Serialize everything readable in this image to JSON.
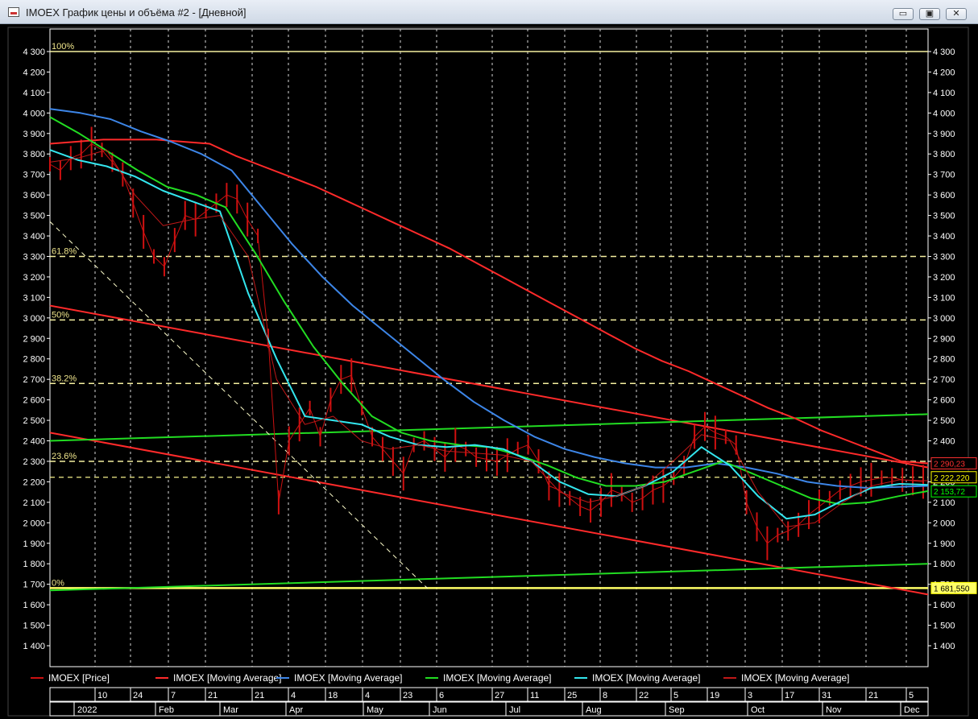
{
  "window": {
    "title": "IMOEX График цены и объёма #2 - [Дневной]",
    "minimize_glyph": "▭",
    "maximize_glyph": "▣",
    "close_glyph": "✕"
  },
  "chart_data": {
    "type": "line",
    "ylim": [
      1350,
      4400
    ],
    "y_ticks": [
      "1 400",
      "1 500",
      "1 600",
      "1 700",
      "1 800",
      "1 900",
      "2 000",
      "2 100",
      "2 200",
      "2 300",
      "2 400",
      "2 500",
      "2 600",
      "2 700",
      "2 800",
      "2 900",
      "3 000",
      "3 100",
      "3 200",
      "3 300",
      "3 400",
      "3 500",
      "3 600",
      "3 700",
      "3 800",
      "3 900",
      "4 000",
      "4 100",
      "4 200",
      "4 300"
    ],
    "x_day_ticks": [
      "10",
      "24",
      "7",
      "21",
      "21",
      "4",
      "18",
      "4",
      "23",
      "6",
      "27",
      "11",
      "25",
      "8",
      "22",
      "5",
      "19",
      "3",
      "17",
      "31",
      "21",
      "5"
    ],
    "x_month_ticks": [
      "2022",
      "Feb",
      "Mar",
      "Apr",
      "May",
      "Jun",
      "Jul",
      "Aug",
      "Sep",
      "Oct",
      "Nov",
      "Dec"
    ],
    "fibonacci_levels": [
      {
        "label": "100%",
        "value": 4300
      },
      {
        "label": "61.8%",
        "value": 3300
      },
      {
        "label": "50%",
        "value": 2990
      },
      {
        "label": "38.2%",
        "value": 2680
      },
      {
        "label": "23.6%",
        "value": 2300
      },
      {
        "label": "0%",
        "value": 1681.55
      }
    ],
    "extra_level": 2222.22,
    "price_labels": [
      {
        "text": "2 290,23",
        "value": 2290.23,
        "color": "#ff3030"
      },
      {
        "text": "2 222,220",
        "value": 2222.22,
        "color": "#ffff00"
      },
      {
        "text": "2 153,72",
        "value": 2153.72,
        "color": "#00ff00"
      },
      {
        "text": "1 681,550",
        "value": 1681.55,
        "color": "#ffff00"
      }
    ],
    "series": [
      {
        "name": "IMOEX [Price]",
        "color": "#cc1111",
        "values": [
          3750,
          3720,
          3780,
          3800,
          3850,
          3820,
          3760,
          3700,
          3560,
          3420,
          3300,
          3250,
          3380,
          3500,
          3480,
          3520,
          3560,
          3600,
          3580,
          3480,
          3400,
          2900,
          2100,
          2400,
          2480,
          2560,
          2420,
          2600,
          2700,
          2720,
          2560,
          2420,
          2360,
          2300,
          2240,
          2380,
          2400,
          2360,
          2320,
          2380,
          2360,
          2320,
          2310,
          2300,
          2330,
          2360,
          2380,
          2300,
          2180,
          2160,
          2120,
          2080,
          2060,
          2100,
          2160,
          2140,
          2100,
          2120,
          2160,
          2180,
          2220,
          2280,
          2420,
          2470,
          2440,
          2420,
          2380,
          2100,
          1980,
          1900,
          1940,
          1960,
          1990,
          2040,
          2080,
          2120,
          2160,
          2180,
          2200,
          2210,
          2220,
          2220,
          2210,
          2205,
          2200
        ]
      },
      {
        "name": "IMOEX [Moving Average]",
        "color": "#ff2a2a",
        "values": [
          3850,
          3860,
          3870,
          3870,
          3870,
          3860,
          3850,
          3790,
          3740,
          3690,
          3640,
          3580,
          3520,
          3460,
          3400,
          3340,
          3270,
          3200,
          3130,
          3060,
          2990,
          2920,
          2850,
          2790,
          2740,
          2680,
          2620,
          2560,
          2510,
          2450,
          2400,
          2350,
          2300,
          2290
        ]
      },
      {
        "name": "IMOEX [Moving Average]",
        "color": "#3d86e8",
        "values": [
          4020,
          4000,
          3970,
          3910,
          3860,
          3800,
          3720,
          3540,
          3360,
          3200,
          3060,
          2940,
          2820,
          2700,
          2590,
          2500,
          2420,
          2360,
          2320,
          2290,
          2270,
          2270,
          2290,
          2270,
          2240,
          2200,
          2180,
          2170,
          2175,
          2180
        ]
      },
      {
        "name": "IMOEX [Moving Average]",
        "color": "#22dd22",
        "values": [
          3980,
          3900,
          3810,
          3720,
          3640,
          3600,
          3540,
          3320,
          3080,
          2860,
          2680,
          2520,
          2440,
          2400,
          2380,
          2370,
          2330,
          2280,
          2220,
          2180,
          2180,
          2200,
          2250,
          2300,
          2240,
          2180,
          2120,
          2090,
          2100,
          2130,
          2155
        ]
      },
      {
        "name": "IMOEX [Moving Average]",
        "color": "#33e6ee",
        "values": [
          3820,
          3770,
          3740,
          3690,
          3620,
          3570,
          3520,
          3120,
          2800,
          2520,
          2500,
          2480,
          2420,
          2380,
          2370,
          2380,
          2360,
          2300,
          2200,
          2140,
          2130,
          2180,
          2250,
          2370,
          2280,
          2130,
          2020,
          2040,
          2110,
          2170,
          2190,
          2185
        ]
      },
      {
        "name": "IMOEX [Moving Average]",
        "color": "#c01818",
        "values": [
          3760,
          3780,
          3820,
          3600,
          3450,
          3480,
          3500,
          3300,
          2700,
          2480,
          2520,
          2400,
          2360,
          2380,
          2350,
          2340,
          2330,
          2300,
          2150,
          2100,
          2130,
          2180,
          2300,
          2430,
          2400,
          2150,
          1980,
          2000,
          2100,
          2180,
          2210,
          2205
        ]
      }
    ],
    "trendlines": [
      {
        "name": "upper-red-channel",
        "color": "#ff2a2a",
        "from": [
          0,
          3060
        ],
        "to": [
          1,
          2270
        ]
      },
      {
        "name": "lower-red-channel",
        "color": "#ff2a2a",
        "from": [
          0,
          2440
        ],
        "to": [
          1,
          1650
        ]
      },
      {
        "name": "upper-green-channel",
        "color": "#22dd22",
        "from": [
          0,
          2400
        ],
        "to": [
          1,
          2530
        ]
      },
      {
        "name": "lower-green-channel",
        "color": "#22dd22",
        "from": [
          0,
          1670
        ],
        "to": [
          1,
          1800
        ]
      },
      {
        "name": "dashed-decline",
        "color": "#ffffcc",
        "from": [
          0,
          3470
        ],
        "to": [
          0.43,
          1680
        ]
      }
    ],
    "legend": [
      {
        "label": "IMOEX [Price]",
        "color": "#cc1111"
      },
      {
        "label": "IMOEX [Moving Average]",
        "color": "#ff2a2a"
      },
      {
        "label": "IMOEX [Moving Average]",
        "color": "#3d86e8"
      },
      {
        "label": "IMOEX [Moving Average]",
        "color": "#22dd22"
      },
      {
        "label": "IMOEX [Moving Average]",
        "color": "#33e6ee"
      },
      {
        "label": "IMOEX [Moving Average]",
        "color": "#c01818"
      }
    ],
    "grid": true
  }
}
